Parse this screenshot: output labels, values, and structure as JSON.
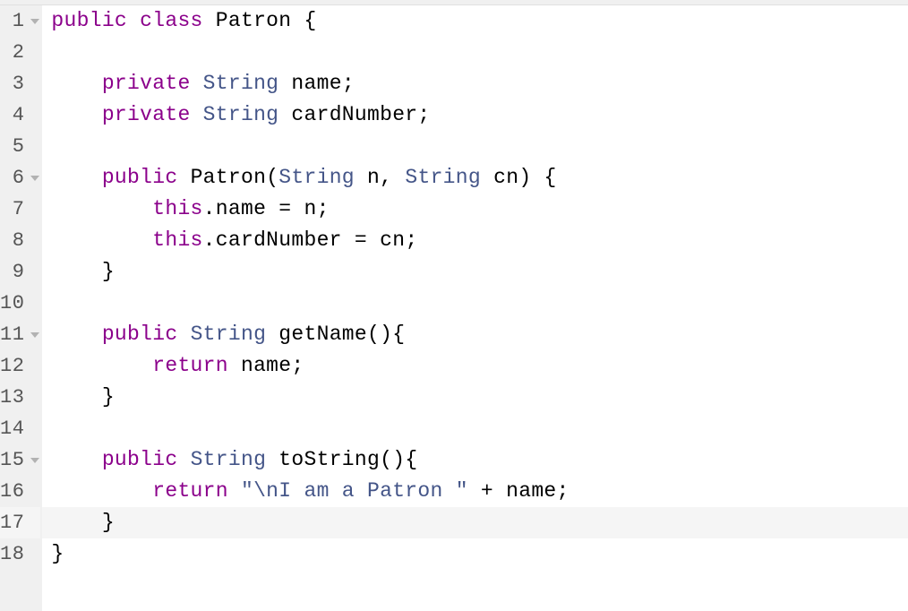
{
  "editor": {
    "highlighted_line": 17,
    "lines": [
      {
        "num": 1,
        "foldable": true,
        "tokens": [
          {
            "t": "public",
            "c": "tok-modifier"
          },
          {
            "t": " ",
            "c": ""
          },
          {
            "t": "class",
            "c": "tok-keyword"
          },
          {
            "t": " ",
            "c": ""
          },
          {
            "t": "Patron",
            "c": "tok-ident"
          },
          {
            "t": " ",
            "c": ""
          },
          {
            "t": "{",
            "c": "tok-punct"
          }
        ]
      },
      {
        "num": 2,
        "foldable": false,
        "tokens": []
      },
      {
        "num": 3,
        "foldable": false,
        "tokens": [
          {
            "t": "    ",
            "c": ""
          },
          {
            "t": "private",
            "c": "tok-modifier"
          },
          {
            "t": " ",
            "c": ""
          },
          {
            "t": "String",
            "c": "tok-type"
          },
          {
            "t": " ",
            "c": ""
          },
          {
            "t": "name",
            "c": "tok-ident"
          },
          {
            "t": ";",
            "c": "tok-punct"
          }
        ]
      },
      {
        "num": 4,
        "foldable": false,
        "tokens": [
          {
            "t": "    ",
            "c": ""
          },
          {
            "t": "private",
            "c": "tok-modifier"
          },
          {
            "t": " ",
            "c": ""
          },
          {
            "t": "String",
            "c": "tok-type"
          },
          {
            "t": " ",
            "c": ""
          },
          {
            "t": "cardNumber",
            "c": "tok-ident"
          },
          {
            "t": ";",
            "c": "tok-punct"
          }
        ]
      },
      {
        "num": 5,
        "foldable": false,
        "tokens": []
      },
      {
        "num": 6,
        "foldable": true,
        "tokens": [
          {
            "t": "    ",
            "c": ""
          },
          {
            "t": "public",
            "c": "tok-modifier"
          },
          {
            "t": " ",
            "c": ""
          },
          {
            "t": "Patron",
            "c": "tok-ident"
          },
          {
            "t": "(",
            "c": "tok-punct"
          },
          {
            "t": "String",
            "c": "tok-type"
          },
          {
            "t": " ",
            "c": ""
          },
          {
            "t": "n",
            "c": "tok-ident"
          },
          {
            "t": ", ",
            "c": "tok-punct"
          },
          {
            "t": "String",
            "c": "tok-type"
          },
          {
            "t": " ",
            "c": ""
          },
          {
            "t": "cn",
            "c": "tok-ident"
          },
          {
            "t": ")",
            "c": "tok-punct"
          },
          {
            "t": " ",
            "c": ""
          },
          {
            "t": "{",
            "c": "tok-punct"
          }
        ]
      },
      {
        "num": 7,
        "foldable": false,
        "tokens": [
          {
            "t": "        ",
            "c": ""
          },
          {
            "t": "this",
            "c": "tok-this"
          },
          {
            "t": ".",
            "c": "tok-punct"
          },
          {
            "t": "name",
            "c": "tok-ident"
          },
          {
            "t": " = ",
            "c": "tok-op"
          },
          {
            "t": "n",
            "c": "tok-ident"
          },
          {
            "t": ";",
            "c": "tok-punct"
          }
        ]
      },
      {
        "num": 8,
        "foldable": false,
        "tokens": [
          {
            "t": "        ",
            "c": ""
          },
          {
            "t": "this",
            "c": "tok-this"
          },
          {
            "t": ".",
            "c": "tok-punct"
          },
          {
            "t": "cardNumber",
            "c": "tok-ident"
          },
          {
            "t": " = ",
            "c": "tok-op"
          },
          {
            "t": "cn",
            "c": "tok-ident"
          },
          {
            "t": ";",
            "c": "tok-punct"
          }
        ]
      },
      {
        "num": 9,
        "foldable": false,
        "tokens": [
          {
            "t": "    ",
            "c": ""
          },
          {
            "t": "}",
            "c": "tok-punct"
          }
        ]
      },
      {
        "num": 10,
        "foldable": false,
        "tokens": []
      },
      {
        "num": 11,
        "foldable": true,
        "tokens": [
          {
            "t": "    ",
            "c": ""
          },
          {
            "t": "public",
            "c": "tok-modifier"
          },
          {
            "t": " ",
            "c": ""
          },
          {
            "t": "String",
            "c": "tok-type"
          },
          {
            "t": " ",
            "c": ""
          },
          {
            "t": "getName",
            "c": "tok-method"
          },
          {
            "t": "()",
            "c": "tok-punct"
          },
          {
            "t": "{",
            "c": "tok-punct"
          }
        ]
      },
      {
        "num": 12,
        "foldable": false,
        "tokens": [
          {
            "t": "        ",
            "c": ""
          },
          {
            "t": "return",
            "c": "tok-return"
          },
          {
            "t": " ",
            "c": ""
          },
          {
            "t": "name",
            "c": "tok-ident"
          },
          {
            "t": ";",
            "c": "tok-punct"
          }
        ]
      },
      {
        "num": 13,
        "foldable": false,
        "tokens": [
          {
            "t": "    ",
            "c": ""
          },
          {
            "t": "}",
            "c": "tok-punct"
          }
        ]
      },
      {
        "num": 14,
        "foldable": false,
        "tokens": []
      },
      {
        "num": 15,
        "foldable": true,
        "tokens": [
          {
            "t": "    ",
            "c": ""
          },
          {
            "t": "public",
            "c": "tok-modifier"
          },
          {
            "t": " ",
            "c": ""
          },
          {
            "t": "String",
            "c": "tok-type"
          },
          {
            "t": " ",
            "c": ""
          },
          {
            "t": "toString",
            "c": "tok-method"
          },
          {
            "t": "()",
            "c": "tok-punct"
          },
          {
            "t": "{",
            "c": "tok-punct"
          }
        ]
      },
      {
        "num": 16,
        "foldable": false,
        "tokens": [
          {
            "t": "        ",
            "c": ""
          },
          {
            "t": "return",
            "c": "tok-return"
          },
          {
            "t": " ",
            "c": ""
          },
          {
            "t": "\"\\nI am a Patron \"",
            "c": "tok-string"
          },
          {
            "t": " + ",
            "c": "tok-op"
          },
          {
            "t": "name",
            "c": "tok-ident"
          },
          {
            "t": ";",
            "c": "tok-punct"
          }
        ]
      },
      {
        "num": 17,
        "foldable": false,
        "tokens": [
          {
            "t": "    ",
            "c": ""
          },
          {
            "t": "}",
            "c": "tok-punct"
          }
        ]
      },
      {
        "num": 18,
        "foldable": false,
        "tokens": [
          {
            "t": "}",
            "c": "tok-punct"
          }
        ]
      }
    ]
  }
}
